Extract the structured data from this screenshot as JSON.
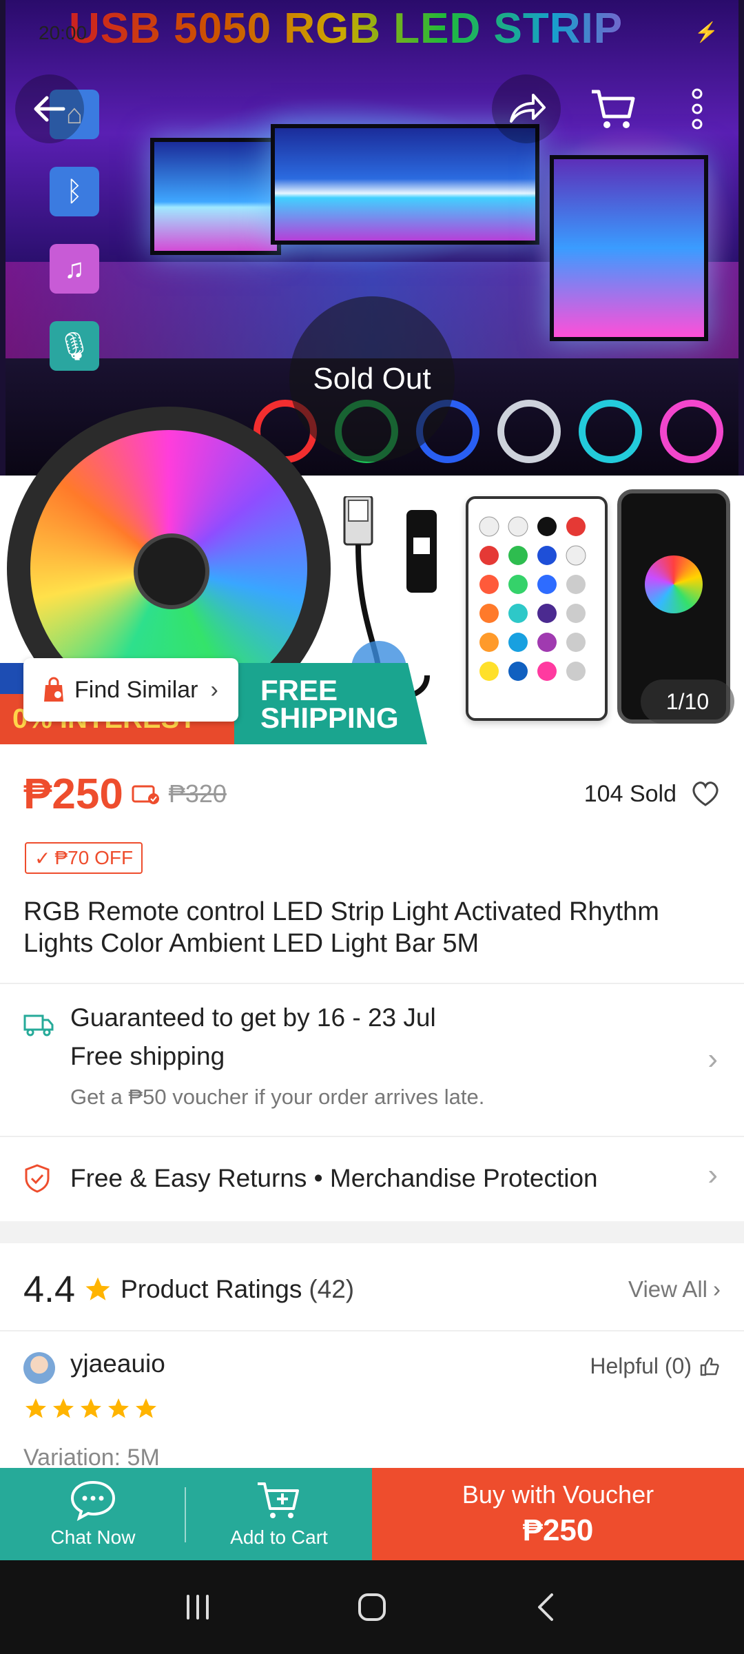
{
  "status_bar": {
    "time": "20:00",
    "battery_icon": "charging-bolt-icon"
  },
  "hero": {
    "banner_title": "USB 5050 RGB LED STRIP",
    "sold_out": "Sold Out",
    "promo_interest": "0% INTEREST",
    "promo_shipping_line1": "FREE",
    "promo_shipping_line2": "SHIPPING",
    "find_similar": "Find Similar",
    "image_counter": "1/10"
  },
  "header_actions": [
    "back-arrow-icon",
    "share-icon",
    "cart-icon",
    "more-vertical-icon"
  ],
  "price": {
    "current": "₱250",
    "original": "₱320",
    "sold": "104 Sold",
    "discount_tag": "₱70 OFF"
  },
  "product": {
    "title": "RGB Remote control LED Strip Light Activated Rhythm Lights Color Ambient LED Light Bar 5M"
  },
  "shipping": {
    "guarantee": "Guaranteed to get by 16 - 23 Jul",
    "free": "Free shipping",
    "voucher_note": "Get a ₱50 voucher if your order arrives late."
  },
  "returns": {
    "line": "Free & Easy Returns  •  Merchandise Protection"
  },
  "ratings": {
    "score": "4.4",
    "title": "Product Ratings",
    "count": "(42)",
    "view_all": "View All"
  },
  "review": {
    "user": "yjaeauio",
    "helpful": "Helpful (0)",
    "stars": 5,
    "variation": "Variation: 5M"
  },
  "action_bar": {
    "chat": "Chat Now",
    "add_to_cart": "Add to Cart",
    "buy_label": "Buy with Voucher",
    "buy_price": "₱250"
  },
  "colors": {
    "brand_orange": "#ee4d2d",
    "teal": "#26aa99"
  }
}
